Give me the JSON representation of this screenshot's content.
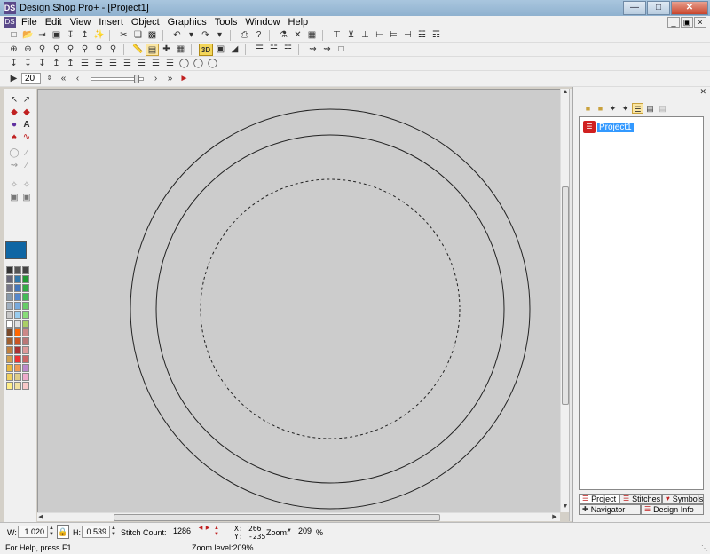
{
  "window": {
    "title": "Design Shop Pro+ - [Project1]",
    "app_icon": "DS"
  },
  "menu": [
    "File",
    "Edit",
    "View",
    "Insert",
    "Object",
    "Graphics",
    "Tools",
    "Window",
    "Help"
  ],
  "animation": {
    "step_value": "20"
  },
  "colors": {
    "current": "#0f66a4",
    "palette": [
      "#333333",
      "#555555",
      "#444444",
      "#666677",
      "#3377aa",
      "#229933",
      "#777788",
      "#4477bb",
      "#33aa44",
      "#8899aa",
      "#5588cc",
      "#44bb55",
      "#a0b0c0",
      "#77aadd",
      "#66cc66",
      "#c8c8c8",
      "#99ccee",
      "#88dd77",
      "#ffffff",
      "#e0e0e0",
      "#aad066",
      "#7a4a2a",
      "#ff6600",
      "#cc8888",
      "#a06030",
      "#cc5522",
      "#bb7777",
      "#c08040",
      "#aa3333",
      "#dd9999",
      "#d0a050",
      "#ee3333",
      "#cc6666",
      "#e8b840",
      "#ee9955",
      "#bb88cc",
      "#f0d060",
      "#ddcc88",
      "#eeaacc",
      "#ffee88",
      "#f0e0a0",
      "#f8c8c8"
    ]
  },
  "project_panel": {
    "tree_item": "Project1",
    "tabs": {
      "project": "Project",
      "stitches": "Stitches",
      "symbols": "Symbols",
      "navigator": "Navigator",
      "design_info": "Design Info"
    }
  },
  "status": {
    "w_label": "W:",
    "w_value": "1.020",
    "h_label": "H:",
    "h_value": "0.539",
    "stitch_label": "Stitch Count:",
    "stitch_value": "1286",
    "x_label": "X:",
    "x_value": "266",
    "y_label": "Y:",
    "y_value": "-235",
    "zoom_label": "Zoom:",
    "zoom_value": "209",
    "zoom_unit": "%"
  },
  "footer": {
    "help": "For Help, press F1",
    "zoom_level": "Zoom level:209%"
  }
}
